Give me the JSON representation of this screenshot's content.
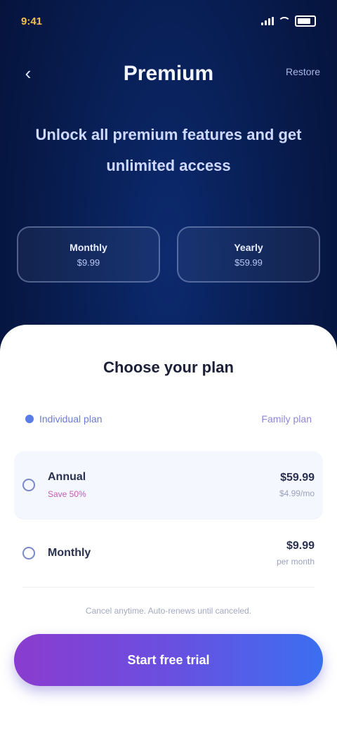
{
  "status_bar": {
    "time": "9:41"
  },
  "header": {
    "title": "Premium",
    "back_icon": "back-arrow-icon",
    "help_label": "Restore"
  },
  "headline": "Unlock all premium features and get unlimited access",
  "plans": [
    {
      "name": "Monthly",
      "price": "$9.99"
    },
    {
      "name": "Yearly",
      "price": "$59.99"
    }
  ],
  "sheet": {
    "title": "Choose your plan",
    "tabs": [
      {
        "label": "Individual plan"
      },
      {
        "label": "Family plan"
      }
    ],
    "options": [
      {
        "label": "Annual",
        "sub": "Save 50%",
        "price": "$59.99",
        "note": "$4.99/mo"
      },
      {
        "label": "Monthly",
        "sub": "",
        "price": "$9.99",
        "note": "per month"
      }
    ],
    "footnote": "Cancel anytime. Auto-renews until canceled.",
    "cta_label": "Start free trial"
  },
  "colors": {
    "background": "#071a4a",
    "accent_start": "#8a3ccf",
    "accent_end": "#3b6ff0"
  }
}
